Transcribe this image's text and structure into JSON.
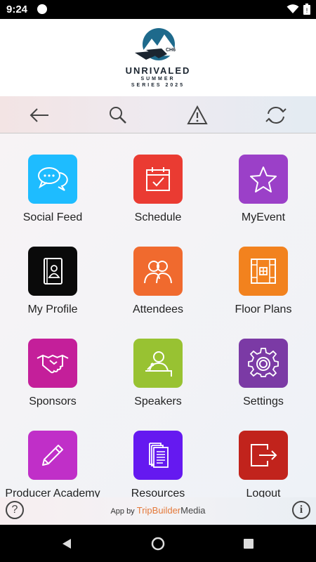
{
  "status_bar": {
    "time": "9:24"
  },
  "header": {
    "logo_title": "UNRIVALED",
    "logo_subtitle_1": "SUMMER",
    "logo_subtitle_2": "SERIES 2025",
    "logo_badge": "CH6"
  },
  "toolbar": {
    "back_icon": "arrow-left-icon",
    "search_icon": "search-icon",
    "alert_icon": "warning-icon",
    "sync_icon": "refresh-icon"
  },
  "tiles": [
    {
      "label": "Social Feed",
      "color": "#1ebcff",
      "icon": "chat-bubbles-icon"
    },
    {
      "label": "Schedule",
      "color": "#ea3b32",
      "icon": "calendar-check-icon"
    },
    {
      "label": "MyEvent",
      "color": "#9b40c8",
      "icon": "star-icon"
    },
    {
      "label": "My Profile",
      "color": "#0a0a0a",
      "icon": "profile-book-icon"
    },
    {
      "label": "Attendees",
      "color": "#f06a2e",
      "icon": "people-icon"
    },
    {
      "label": "Floor Plans",
      "color": "#f2821e",
      "icon": "floor-plan-icon"
    },
    {
      "label": "Sponsors",
      "color": "#c41f9a",
      "icon": "handshake-icon"
    },
    {
      "label": "Speakers",
      "color": "#98c232",
      "icon": "speaker-podium-icon"
    },
    {
      "label": "Settings",
      "color": "#7b3aa5",
      "icon": "gear-icon"
    },
    {
      "label": "Producer Academy",
      "color": "#c02fc8",
      "icon": "pencil-icon"
    },
    {
      "label": "Resources",
      "color": "#6519f0",
      "icon": "documents-icon"
    },
    {
      "label": "Logout",
      "color": "#c1231c",
      "icon": "logout-icon"
    }
  ],
  "footer": {
    "prefix": "App by",
    "brand_part1": "TripBuilder",
    "brand_part2": "Media",
    "help_label": "?",
    "info_label": "i"
  }
}
